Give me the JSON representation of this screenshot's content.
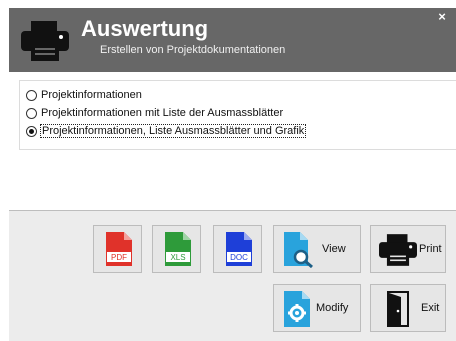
{
  "header": {
    "title": "Auswertung",
    "subtitle": "Erstellen von Projektdokumentationen",
    "icon": "printer-icon",
    "close_glyph": "×",
    "background": "#676767"
  },
  "options": [
    {
      "label": "Projektinformationen",
      "checked": false
    },
    {
      "label": "Projektinformationen mit Liste der Ausmassblätter",
      "checked": false
    },
    {
      "label": "Projektinformationen, Liste Ausmassblätter und Grafik",
      "checked": true
    }
  ],
  "buttons": {
    "pdf": {
      "icon": "pdf-file-icon",
      "badge": "PDF",
      "color": "#e0322a"
    },
    "xls": {
      "icon": "xls-file-icon",
      "badge": "XLS",
      "color": "#2e9b3a"
    },
    "doc": {
      "icon": "doc-file-icon",
      "badge": "DOC",
      "color": "#1e3fd8"
    },
    "view": {
      "icon": "view-file-icon",
      "label": "View",
      "color": "#29a3dc"
    },
    "print": {
      "icon": "printer-icon",
      "label": "Print"
    },
    "modify": {
      "icon": "modify-file-icon",
      "label": "Modify",
      "color": "#29a3dc"
    },
    "exit": {
      "icon": "exit-door-icon",
      "label": "Exit"
    }
  }
}
